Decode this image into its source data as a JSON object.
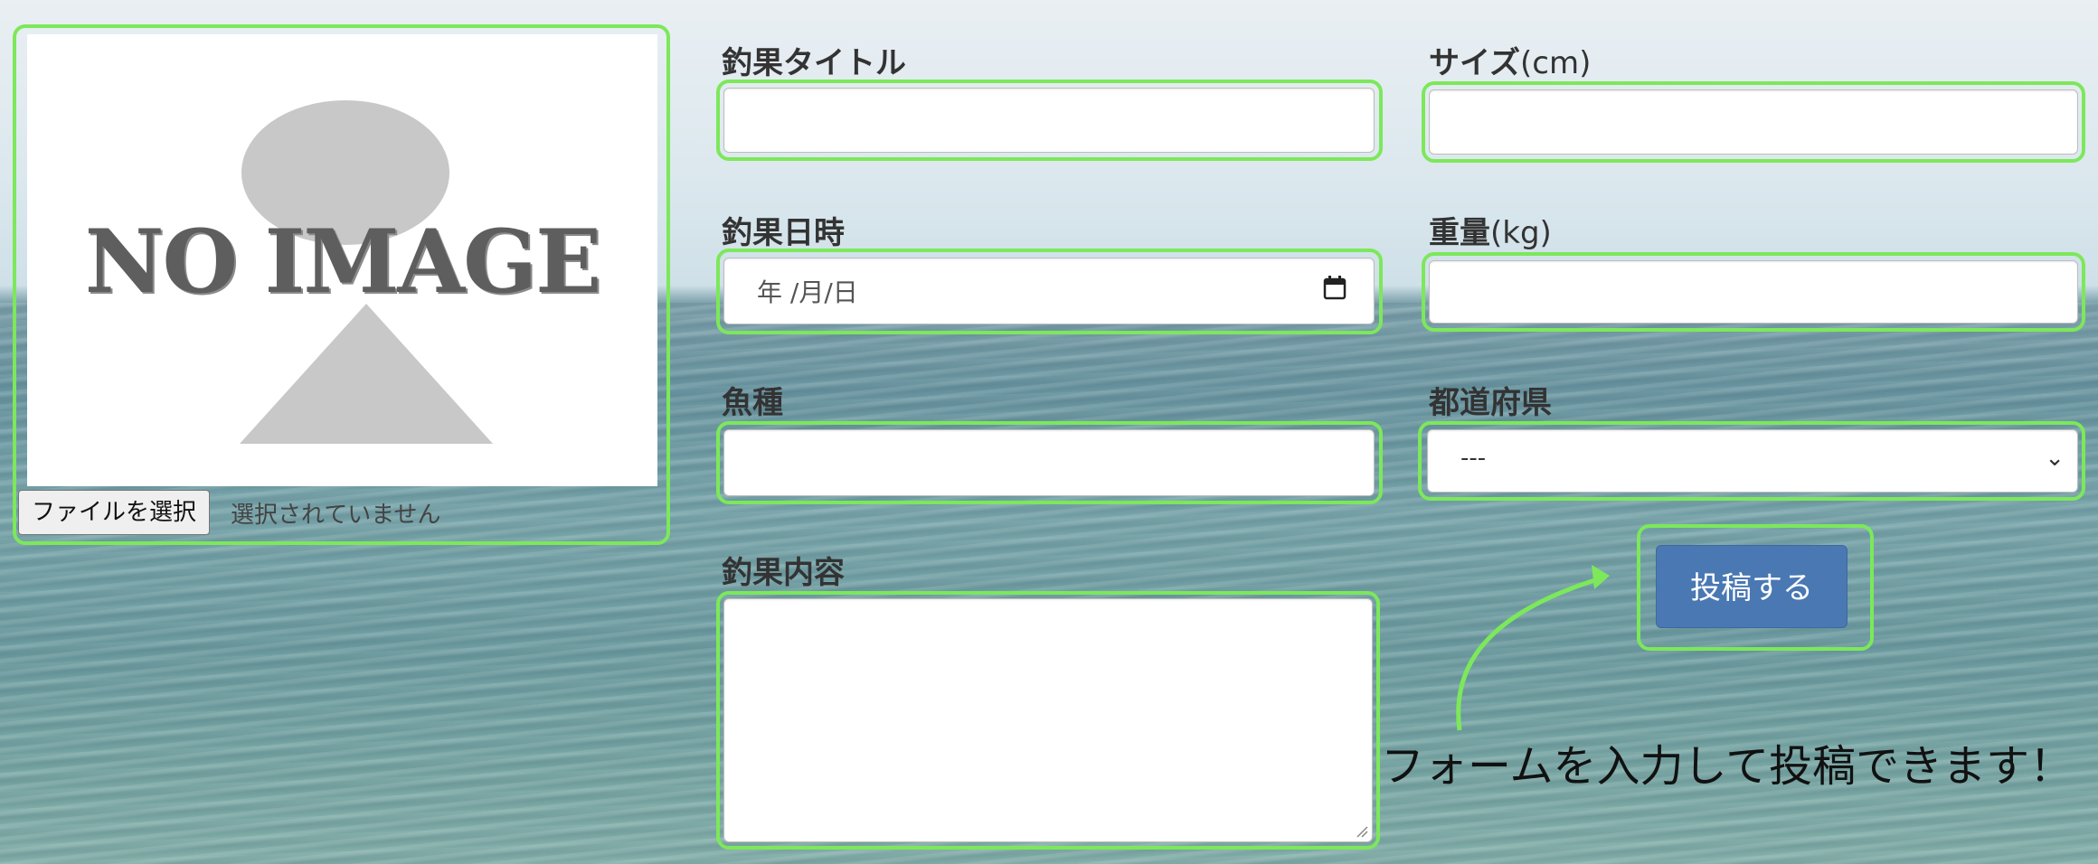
{
  "image_panel": {
    "placeholder_text": "NO IMAGE",
    "file_button_label": "ファイルを選択",
    "file_status": "選択されていません"
  },
  "form": {
    "title_label": "釣果タイトル",
    "size_label": "サイズ",
    "size_unit": "(cm)",
    "date_label": "釣果日時",
    "date_placeholder": "年 /月/日",
    "weight_label": "重量",
    "weight_unit": "(kg)",
    "species_label": "魚種",
    "prefecture_label": "都道府県",
    "prefecture_selected": "---",
    "content_label": "釣果内容",
    "submit_label": "投稿する"
  },
  "annotation": {
    "note": "フォームを入力して投稿できます！",
    "highlight_color": "#7ce85a"
  },
  "colors": {
    "submit_button": "#4a78b3"
  }
}
